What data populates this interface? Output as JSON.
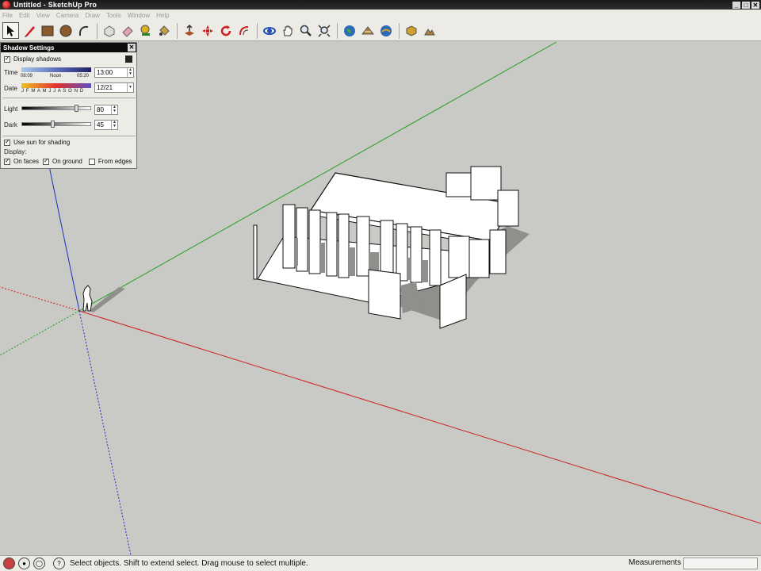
{
  "window": {
    "title": "Untitled - SketchUp Pro"
  },
  "menu": [
    "File",
    "Edit",
    "View",
    "Camera",
    "Draw",
    "Tools",
    "Window",
    "Help"
  ],
  "toolbar": {
    "tools": [
      {
        "name": "select-tool-icon",
        "active": true
      },
      {
        "name": "pencil-line-icon"
      },
      {
        "name": "rectangle-icon"
      },
      {
        "name": "circle-icon"
      },
      {
        "name": "arc-icon"
      },
      {
        "name": "make-component-icon"
      },
      {
        "name": "eraser-icon"
      },
      {
        "name": "tape-measure-icon"
      },
      {
        "name": "paint-bucket-icon"
      },
      {
        "name": "push-pull-icon"
      },
      {
        "name": "move-icon"
      },
      {
        "name": "rotate-icon"
      },
      {
        "name": "offset-icon"
      },
      {
        "name": "orbit-icon"
      },
      {
        "name": "pan-icon"
      },
      {
        "name": "zoom-icon"
      },
      {
        "name": "zoom-extents-icon"
      },
      {
        "name": "google-earth-icon"
      },
      {
        "name": "get-models-icon"
      },
      {
        "name": "share-model-icon"
      },
      {
        "name": "get-current-view-icon"
      },
      {
        "name": "toggle-terrain-icon"
      }
    ]
  },
  "shadow_panel": {
    "title": "Shadow Settings",
    "display_shadows_label": "Display shadows",
    "display_shadows_checked": true,
    "time_label": "Time",
    "time_sunrise": "08:09",
    "time_noon": "Noon",
    "time_sunset": "05:20",
    "time_value": "13:00",
    "date_label": "Date",
    "date_months": "J F M A M J J A S O N D",
    "date_value": "12/21",
    "light_label": "Light",
    "light_value": "80",
    "light_level": 0.8,
    "dark_label": "Dark",
    "dark_value": "45",
    "dark_level": 0.45,
    "use_sun_label": "Use sun for shading",
    "use_sun_checked": true,
    "display_label": "Display:",
    "on_faces_label": "On faces",
    "on_faces_checked": true,
    "on_ground_label": "On ground",
    "on_ground_checked": true,
    "from_edges_label": "From edges",
    "from_edges_checked": false
  },
  "status": {
    "hint": "Select objects. Shift to extend select. Drag mouse to select multiple.",
    "measurements_label": "Measurements",
    "measurements_value": ""
  },
  "colors": {
    "axis_red": "#cc2020",
    "axis_green": "#20a020",
    "axis_blue": "#2030c0",
    "viewport_bg": "#c9c9c5",
    "shadow": "#8f8f8c"
  }
}
